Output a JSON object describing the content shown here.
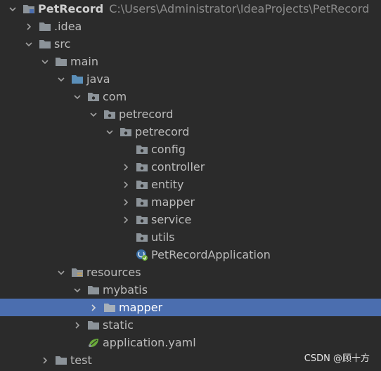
{
  "project": {
    "name": "PetRecord",
    "path": "C:\\Users\\Administrator\\IdeaProjects\\PetRecord"
  },
  "tree": {
    "idea": ".idea",
    "src": "src",
    "main": "main",
    "java": "java",
    "com": "com",
    "petrecord1": "petrecord",
    "petrecord2": "petrecord",
    "config": "config",
    "controller": "controller",
    "entity": "entity",
    "mapper": "mapper",
    "service": "service",
    "utils": "utils",
    "app": "PetRecordApplication",
    "resources": "resources",
    "mybatis": "mybatis",
    "mybatis_mapper": "mapper",
    "static": "static",
    "yaml": "application.yaml",
    "test": "test"
  },
  "selected_item": "mapper",
  "watermark": "CSDN @顾十方",
  "colors": {
    "background": "#2b2b2b",
    "selection": "#4b6eaf",
    "folder": "#8c9399",
    "java_folder": "#5b8fb9",
    "text": "#bbbbbb"
  }
}
